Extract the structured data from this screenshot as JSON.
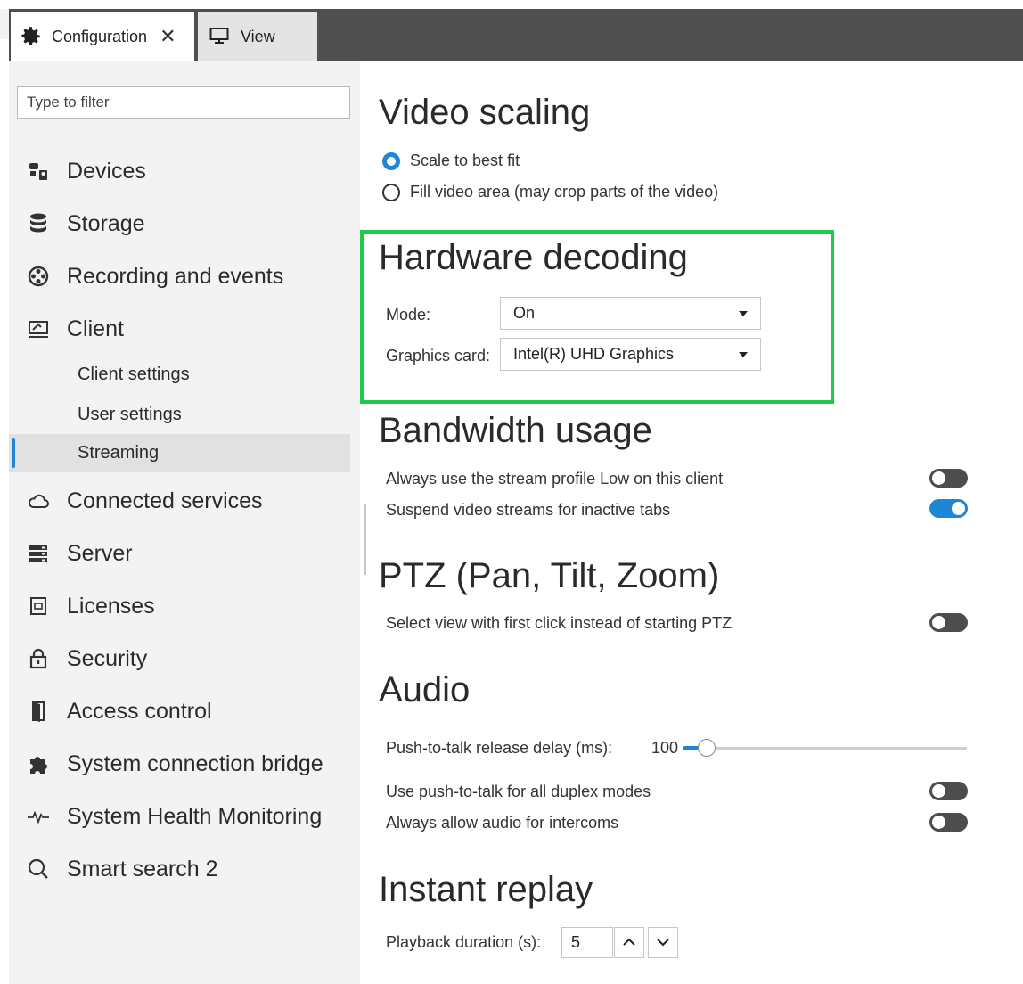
{
  "tabs": {
    "configuration": {
      "label": "Configuration",
      "icon": "gear-icon"
    },
    "view": {
      "label": "View",
      "icon": "monitor-icon"
    },
    "add_icon": "plus-icon"
  },
  "sidebar": {
    "filter_placeholder": "Type to filter",
    "items": [
      {
        "label": "Devices",
        "icon": "devices-icon"
      },
      {
        "label": "Storage",
        "icon": "database-icon"
      },
      {
        "label": "Recording and events",
        "icon": "film-reel-icon"
      },
      {
        "label": "Client",
        "icon": "client-monitor-icon"
      },
      {
        "label": "Connected services",
        "icon": "cloud-icon"
      },
      {
        "label": "Server",
        "icon": "server-icon"
      },
      {
        "label": "Licenses",
        "icon": "license-icon"
      },
      {
        "label": "Security",
        "icon": "lock-icon"
      },
      {
        "label": "Access control",
        "icon": "door-icon"
      },
      {
        "label": "System connection bridge",
        "icon": "puzzle-icon"
      },
      {
        "label": "System Health Monitoring",
        "icon": "heartbeat-icon"
      },
      {
        "label": "Smart search 2",
        "icon": "search-icon"
      }
    ],
    "client_subitems": [
      "Client settings",
      "User settings",
      "Streaming"
    ],
    "active_subitem": "Streaming"
  },
  "video_scaling": {
    "title": "Video scaling",
    "options": [
      "Scale to best fit",
      "Fill video area (may crop parts of the video)"
    ],
    "selected": "Scale to best fit"
  },
  "hardware_decoding": {
    "title": "Hardware decoding",
    "mode_label": "Mode:",
    "mode_value": "On",
    "card_label": "Graphics card:",
    "card_value": "Intel(R) UHD Graphics",
    "highlight_color": "#1fc94a"
  },
  "bandwidth": {
    "title": "Bandwidth usage",
    "low_profile_label": "Always use the stream profile Low on this client",
    "low_profile_on": false,
    "suspend_label": "Suspend video streams for inactive tabs",
    "suspend_on": true
  },
  "ptz": {
    "title": "PTZ (Pan, Tilt, Zoom)",
    "first_click_label": "Select view with first click instead of starting PTZ",
    "first_click_on": false
  },
  "audio": {
    "title": "Audio",
    "delay_label": "Push-to-talk release delay (ms):",
    "delay_value": "100",
    "duplex_label": "Use push-to-talk for all duplex modes",
    "duplex_on": false,
    "intercom_label": "Always allow audio for intercoms",
    "intercom_on": false
  },
  "instant_replay": {
    "title": "Instant replay",
    "duration_label": "Playback duration (s):",
    "duration_value": "5"
  },
  "colors": {
    "accent": "#1f86d6",
    "tabbar": "#4f4f4f",
    "sidebar_bg": "#f3f3f3"
  }
}
